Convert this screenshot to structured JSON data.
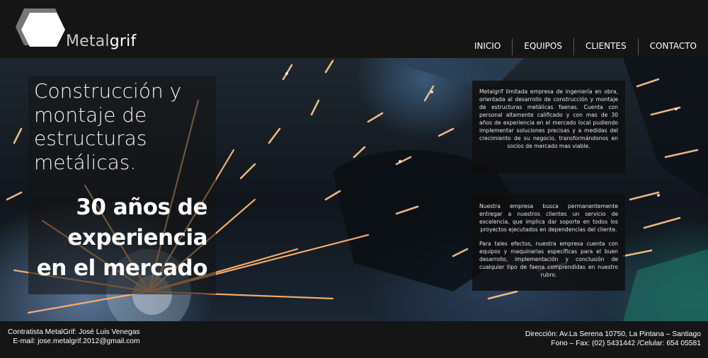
{
  "brand": {
    "name_light": "Metal",
    "name_bold": "grif"
  },
  "nav": {
    "items": [
      "INICIO",
      "EQUIPOS",
      "CLIENTES",
      "CONTACTO"
    ]
  },
  "hero": {
    "headline": "Construcción y montaje de estructuras metálicas.",
    "subline": "30 años de experiencia en el mercado"
  },
  "info": {
    "box1": "Metalgrif limitada empresa de ingeniería en obra, orientada al desarrollo de construcción y montaje de estructuras metálicas faenas. Cuenta con personal altamente calificado y con mas de 30 años de experiencia en el mercado local pudiendo implementar soluciones precisas y a medidas del crecimiento de su negocio, transformándonos en socios de mercado mas viable.",
    "box2_p1": "Nuestra empresa busca permanentemente entregar a nuestros clientes un servicio de excelencia, que implica dar soporte en todos los proyectos ejecutados en dependencias del cliente.",
    "box2_p2": "Para tales efectos, nuestra empresa cuenta con equipos y maquinarias específicas para el buen desarrollo, implementación y conclusión de cualquier tipo de faena comprendidas en nuestro rubro."
  },
  "footer": {
    "contractor": "Contratista MetalGrif: José Luis Venegas",
    "email": "E-mail: jose.metalgrif.2012@gmail.com",
    "address": "Dirección: Av.La Serena 10750, La Pintana – Santiago",
    "phones": "Fono – Fax: (02) 5431442 /Celular: 654 05581"
  },
  "colors": {
    "header_bg": "#151515",
    "spark_hot": "#ffb26b",
    "spark_core": "#fff3e0"
  }
}
